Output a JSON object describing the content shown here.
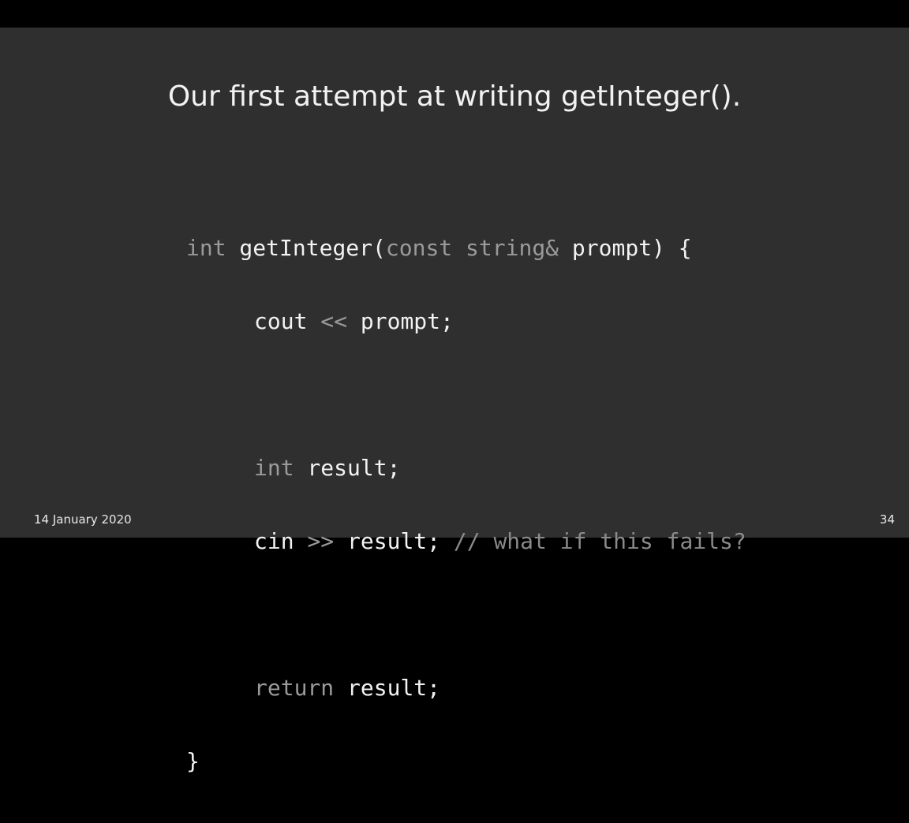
{
  "slide": {
    "title": "Our first attempt at writing getInteger().",
    "code": {
      "l1_kw_int": "int",
      "l1_fn": " getInteger(",
      "l1_kw_const": "const",
      "l1_sp": " ",
      "l1_kw_string": "string&",
      "l1_rest": " prompt) {",
      "l2_a": "cout ",
      "l2_op": "<<",
      "l2_b": " prompt;",
      "l4_kw_int": "int",
      "l4_rest": " result;",
      "l5_a": "cin ",
      "l5_op": ">>",
      "l5_b": " result; ",
      "l5_comment": "// what if this fails?",
      "l7_kw_return": "return",
      "l7_rest": " result;",
      "l8": "}"
    },
    "footer": {
      "date": "14 January 2020",
      "page_number": "34"
    }
  }
}
